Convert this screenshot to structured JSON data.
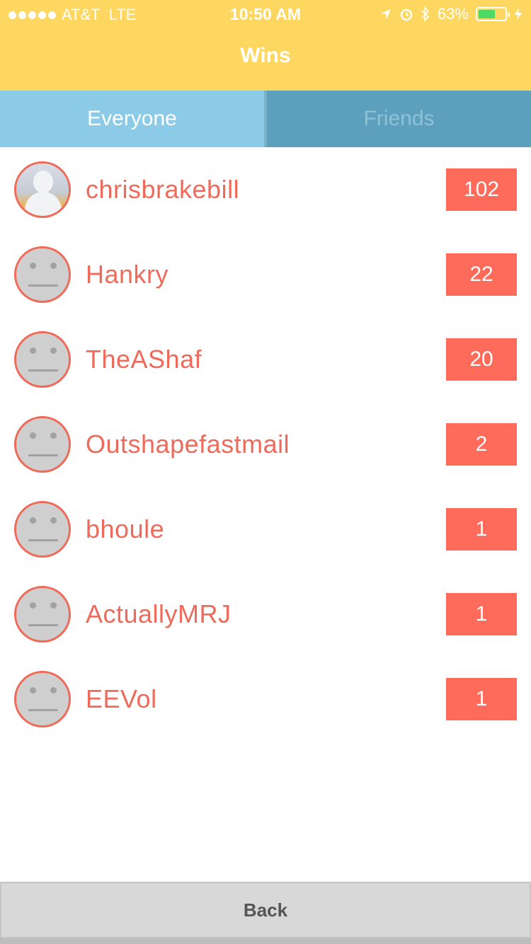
{
  "status_bar": {
    "carrier": "AT&T",
    "network": "LTE",
    "time": "10:50 AM",
    "battery_percent": "63%",
    "battery_level": 0.63,
    "icons": [
      "signal-dots-icon",
      "location-arrow-icon",
      "alarm-icon",
      "bluetooth-icon",
      "battery-icon",
      "charging-bolt-icon"
    ]
  },
  "header": {
    "title": "Wins"
  },
  "tabs": [
    {
      "label": "Everyone",
      "active": true
    },
    {
      "label": "Friends",
      "active": false
    }
  ],
  "leaderboard": [
    {
      "name": "chrisbrakebill",
      "wins": "102",
      "avatar": "photo"
    },
    {
      "name": "Hankry",
      "wins": "22",
      "avatar": "default-face"
    },
    {
      "name": "TheAShaf",
      "wins": "20",
      "avatar": "default-face"
    },
    {
      "name": "Outshapefastmail",
      "wins": "2",
      "avatar": "default-face"
    },
    {
      "name": "bhoule",
      "wins": "1",
      "avatar": "default-face"
    },
    {
      "name": "ActuallyMRJ",
      "wins": "1",
      "avatar": "default-face"
    },
    {
      "name": "EEVol",
      "wins": "1",
      "avatar": "default-face"
    }
  ],
  "footer": {
    "back_label": "Back"
  },
  "colors": {
    "header": "#fdd760",
    "tab_active": "#8ccbe8",
    "tab_inactive": "#5ca0bd",
    "name_text": "#ee6b5b",
    "score_badge": "#fe6b5a",
    "avatar_border": "#f06a5a"
  }
}
